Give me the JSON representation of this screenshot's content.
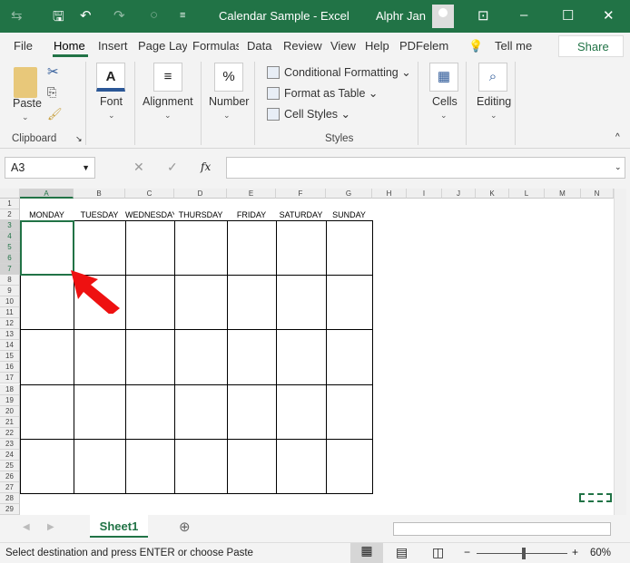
{
  "titlebar": {
    "title": "Calendar Sample  -  Excel",
    "user": "Alphr Jan"
  },
  "tabs": [
    "File",
    "Home",
    "Insert",
    "Page Lay",
    "Formulas",
    "Data",
    "Review",
    "View",
    "Help",
    "PDFelem"
  ],
  "tell_me": "Tell me",
  "share": "Share",
  "ribbon": {
    "paste": "Paste",
    "clipboard": "Clipboard",
    "font": "Font",
    "alignment": "Alignment",
    "number": "Number",
    "number_icon": "%",
    "conditional": "Conditional Formatting",
    "format_table": "Format as Table",
    "cell_styles": "Cell Styles",
    "styles": "Styles",
    "cells": "Cells",
    "editing": "Editing",
    "font_icon": "A"
  },
  "formula_bar": {
    "name_box": "A3",
    "fx": "fx",
    "value": ""
  },
  "columns": [
    "A",
    "B",
    "C",
    "D",
    "E",
    "F",
    "G",
    "H",
    "I",
    "J",
    "K",
    "L",
    "M",
    "N"
  ],
  "rows": [
    "1",
    "2",
    "3",
    "4",
    "5",
    "6",
    "7",
    "8",
    "9",
    "10",
    "11",
    "12",
    "13",
    "14",
    "15",
    "16",
    "17",
    "18",
    "19",
    "20",
    "21",
    "22",
    "23",
    "24",
    "25",
    "26",
    "27",
    "28",
    "29"
  ],
  "days": [
    "MONDAY",
    "TUESDAY",
    "WEDNESDAY",
    "THURSDAY",
    "FRIDAY",
    "SATURDAY",
    "SUNDAY"
  ],
  "sheet_tab": "Sheet1",
  "status": {
    "message": "Select destination and press ENTER or choose Paste",
    "zoom": "60%",
    "zoom_percent": 60
  },
  "colors": {
    "accent": "#217346",
    "arrow": "#ee1111"
  }
}
